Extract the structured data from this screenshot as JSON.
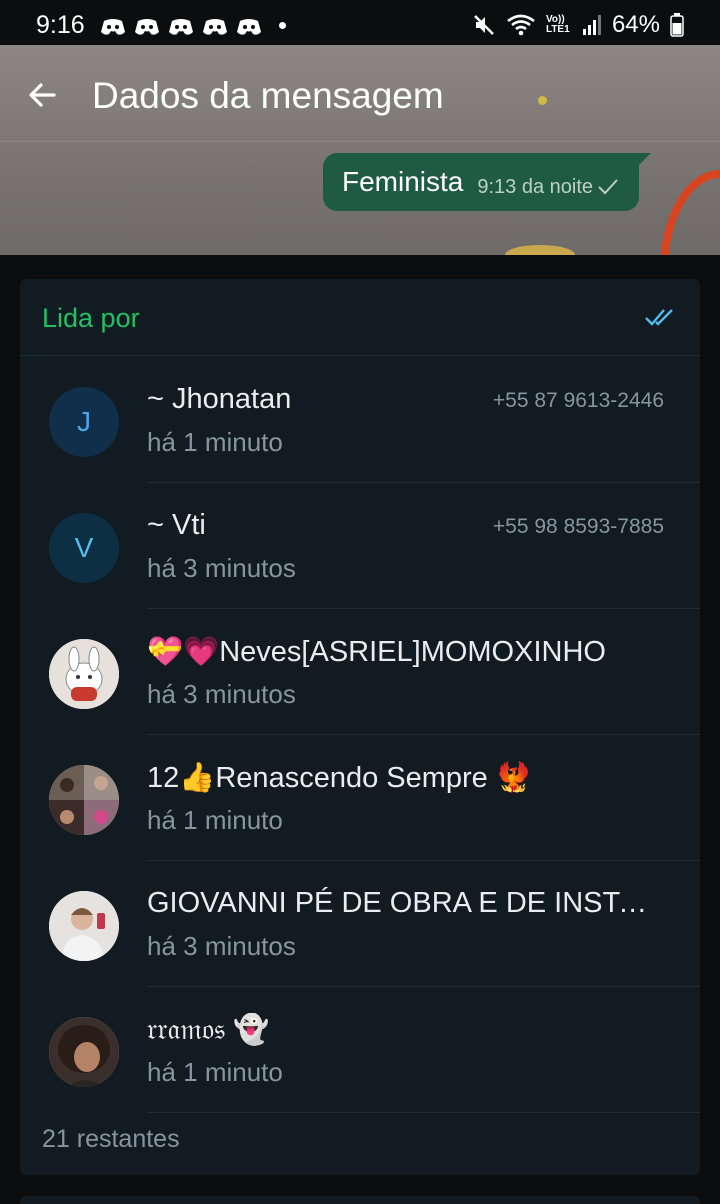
{
  "status_bar": {
    "time": "9:16",
    "lte_label": "Vo)) LTE1",
    "battery": "64%"
  },
  "header": {
    "title": "Dados da mensagem"
  },
  "message": {
    "text": "Feminista",
    "time": "9:13 da noite"
  },
  "read_section": {
    "title": "Lida por",
    "rows": [
      {
        "avatar_letter": "J",
        "name": "~ Jhonatan",
        "phone": "+55 87 9613-2446",
        "time": "há 1 minuto"
      },
      {
        "avatar_letter": "V",
        "name": "~ Vti",
        "phone": "+55 98 8593-7885",
        "time": "há 3 minutos"
      },
      {
        "name": "💝💗Neves[ASRIEL]MOMOXINHO",
        "time": "há 3 minutos"
      },
      {
        "name": "12👍Renascendo Sempre 🐦‍🔥",
        "time": "há 1 minuto"
      },
      {
        "name": "GIOVANNI PÉ DE OBRA E DE INSTALAÇÃO",
        "time": "há 3 minutos"
      },
      {
        "name": "𝔯𝔯𝔞𝔪𝔬𝔰 👻",
        "time": "há 1 minuto"
      }
    ],
    "remaining": "21 restantes"
  },
  "colors": {
    "accent_green": "#21c063",
    "bubble": "#1f5b44",
    "tick_blue": "#53bdeb",
    "card_bg": "#111b21"
  }
}
